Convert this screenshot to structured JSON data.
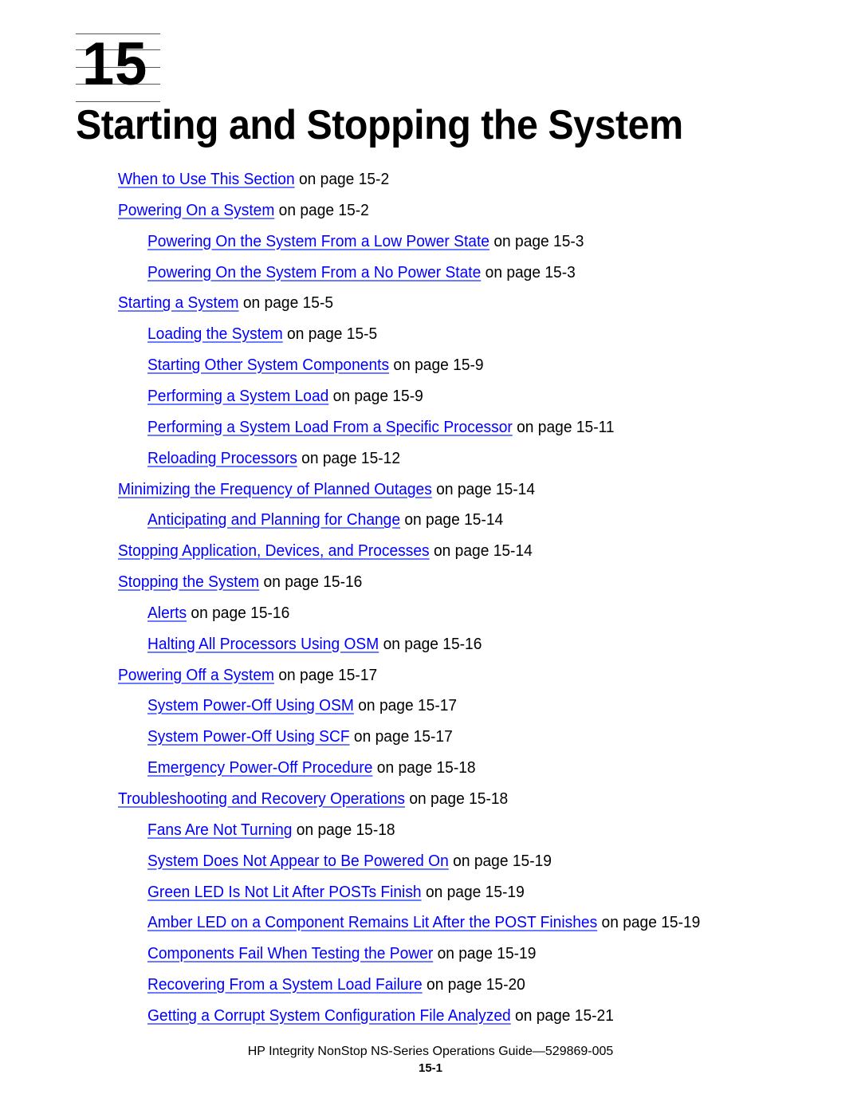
{
  "chapter": {
    "number": "15",
    "title": "Starting and Stopping the System"
  },
  "toc": [
    {
      "level": 1,
      "link": "When to Use This Section",
      "suffix": " on page 15-2"
    },
    {
      "level": 1,
      "link": "Powering On a System",
      "suffix": " on page 15-2"
    },
    {
      "level": 2,
      "link": "Powering On the System From a Low Power State",
      "suffix": " on page 15-3"
    },
    {
      "level": 2,
      "link": "Powering On the System From a No Power State",
      "suffix": " on page 15-3"
    },
    {
      "level": 1,
      "link": "Starting a System",
      "suffix": " on page 15-5"
    },
    {
      "level": 2,
      "link": "Loading the System",
      "suffix": " on page 15-5"
    },
    {
      "level": 2,
      "link": "Starting Other System Components",
      "suffix": " on page 15-9"
    },
    {
      "level": 2,
      "link": "Performing a System Load",
      "suffix": " on page 15-9"
    },
    {
      "level": 2,
      "link": "Performing a System Load From a Specific Processor",
      "suffix": " on page 15-11"
    },
    {
      "level": 2,
      "link": "Reloading Processors",
      "suffix": " on page 15-12"
    },
    {
      "level": 1,
      "link": "Minimizing the Frequency of Planned Outages",
      "suffix": " on page 15-14"
    },
    {
      "level": 2,
      "link": "Anticipating and Planning for Change",
      "suffix": " on page 15-14"
    },
    {
      "level": 1,
      "link": "Stopping Application, Devices, and Processes",
      "suffix": " on page 15-14"
    },
    {
      "level": 1,
      "link": "Stopping the System",
      "suffix": " on page 15-16"
    },
    {
      "level": 2,
      "link": "Alerts",
      "suffix": " on page 15-16"
    },
    {
      "level": 2,
      "link": "Halting All Processors Using OSM",
      "suffix": " on page 15-16"
    },
    {
      "level": 1,
      "link": "Powering Off a System",
      "suffix": " on page 15-17"
    },
    {
      "level": 2,
      "link": "System Power-Off Using OSM",
      "suffix": " on page 15-17"
    },
    {
      "level": 2,
      "link": "System Power-Off Using SCF",
      "suffix": " on page 15-17"
    },
    {
      "level": 2,
      "link": "Emergency Power-Off Procedure",
      "suffix": " on page 15-18"
    },
    {
      "level": 1,
      "link": "Troubleshooting and Recovery Operations",
      "suffix": " on page 15-18"
    },
    {
      "level": 2,
      "link": "Fans Are Not Turning",
      "suffix": " on page 15-18"
    },
    {
      "level": 2,
      "link": "System Does Not Appear to Be Powered On",
      "suffix": " on page 15-19"
    },
    {
      "level": 2,
      "link": "Green LED Is Not Lit After POSTs Finish",
      "suffix": " on page 15-19"
    },
    {
      "level": 2,
      "link": "Amber LED on a Component Remains Lit After the POST Finishes",
      "suffix": " on page 15-19"
    },
    {
      "level": 2,
      "link": "Components Fail When Testing the Power",
      "suffix": " on page 15-19"
    },
    {
      "level": 2,
      "link": "Recovering From a System Load Failure",
      "suffix": " on page 15-20"
    },
    {
      "level": 2,
      "link": "Getting a Corrupt System Configuration File Analyzed",
      "suffix": " on page 15-21"
    }
  ],
  "footer": {
    "title": "HP Integrity NonStop NS-Series Operations Guide—529869-005",
    "page": "15-1"
  },
  "colors": {
    "link": "#0000ff",
    "text": "#000000"
  }
}
